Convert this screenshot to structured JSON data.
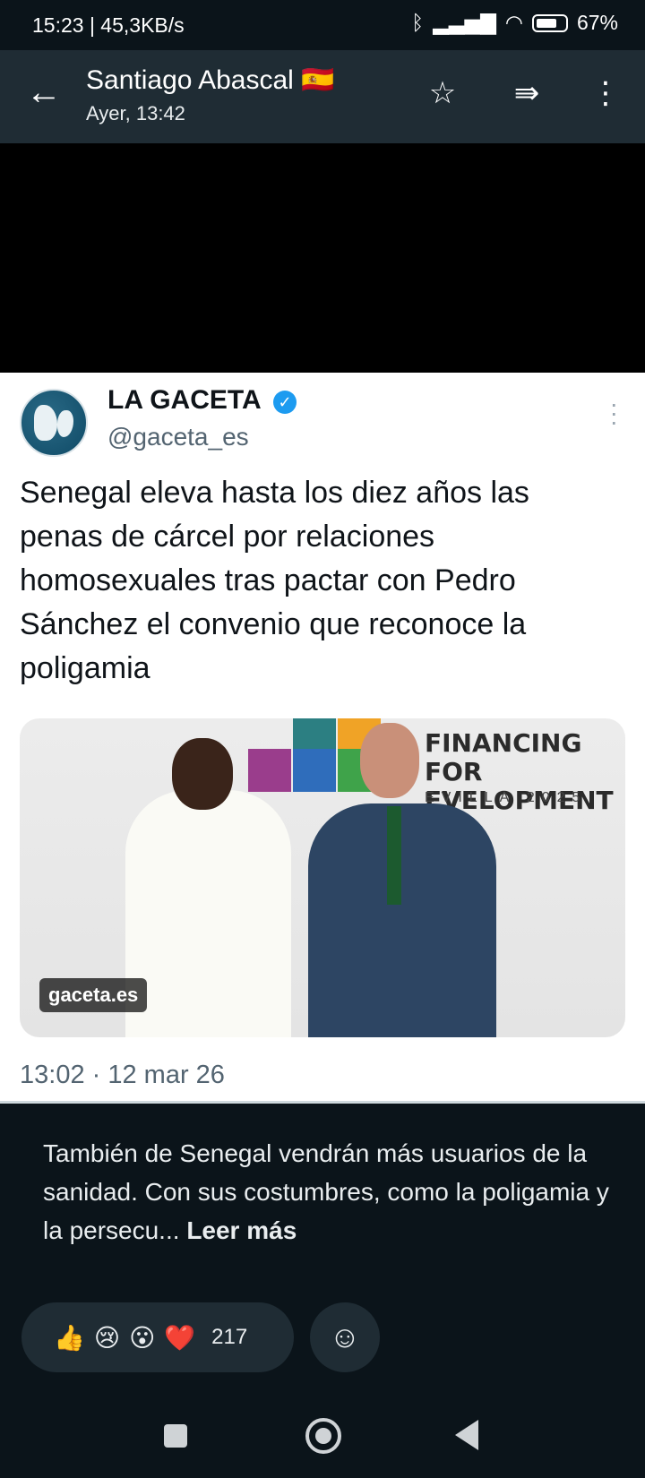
{
  "status_bar": {
    "left": "15:23 | 45,3KB/s",
    "battery": "67%"
  },
  "header": {
    "contact_name": "Santiago Abascal 🇪🇸",
    "subtitle": "Ayer, 13:42"
  },
  "tweet": {
    "author_name": "LA GACETA",
    "handle": "@gaceta_es",
    "text": "Senegal eleva hasta los diez años las penas de cárcel por relaciones homosexuales tras pactar con Pedro Sánchez el convenio que reconoce la poligamia",
    "image_banner_line1": "FINANCING FOR",
    "image_banner_line2": "EVELOPMENT",
    "image_banner_line3": "EVILLA 2025",
    "image_source_badge": "gaceta.es",
    "timestamp": "13:02 · 12 mar 26"
  },
  "caption": {
    "text": "También de Senegal vendrán más usuarios de la sanidad. Con sus costumbres, como la poligamia y la persecu...",
    "read_more": "Leer más"
  },
  "reactions": {
    "emojis": [
      "👍",
      "😢",
      "😮",
      "❤️"
    ],
    "count": "217"
  }
}
